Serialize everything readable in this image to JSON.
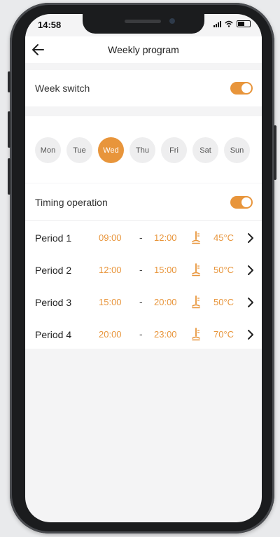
{
  "status_bar": {
    "time": "14:58"
  },
  "header": {
    "title": "Weekly program",
    "back_icon": "arrow-left-icon"
  },
  "week_switch": {
    "label": "Week switch",
    "on": true
  },
  "days": [
    {
      "label": "Mon",
      "active": false
    },
    {
      "label": "Tue",
      "active": false
    },
    {
      "label": "Wed",
      "active": true
    },
    {
      "label": "Thu",
      "active": false
    },
    {
      "label": "Fri",
      "active": false
    },
    {
      "label": "Sat",
      "active": false
    },
    {
      "label": "Sun",
      "active": false
    }
  ],
  "timing_operation": {
    "label": "Timing operation",
    "on": true
  },
  "periods": [
    {
      "label": "Period 1",
      "start": "09:00",
      "end": "12:00",
      "temp": "45°C"
    },
    {
      "label": "Period 2",
      "start": "12:00",
      "end": "15:00",
      "temp": "50°C"
    },
    {
      "label": "Period 3",
      "start": "15:00",
      "end": "20:00",
      "temp": "50°C"
    },
    {
      "label": "Period 4",
      "start": "20:00",
      "end": "23:00",
      "temp": "70°C"
    }
  ],
  "separator": "-",
  "colors": {
    "accent": "#e8953b",
    "background": "#f4f4f5"
  }
}
